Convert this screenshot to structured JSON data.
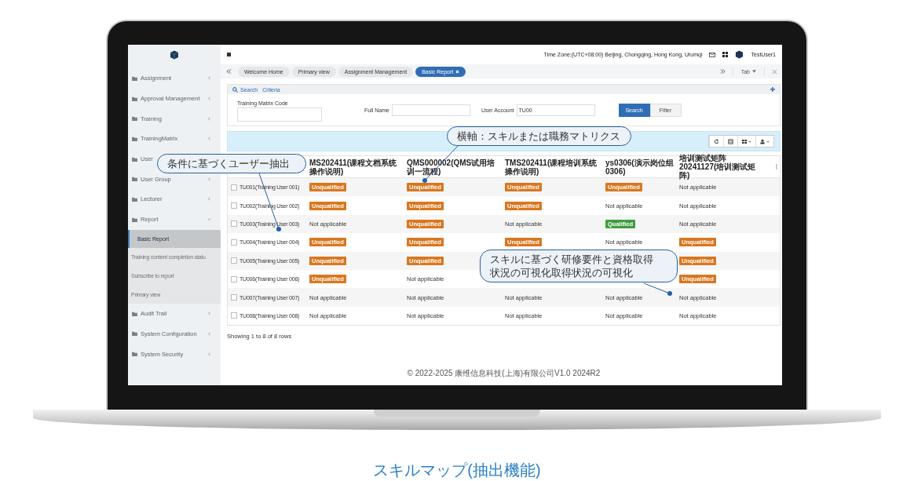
{
  "topbar": {
    "timezone": "Time Zone:(UTC+08:00) Beijing, Chongqing, Hong Kong, Urumqi",
    "user": "TestUser1"
  },
  "sidebar": {
    "items": [
      {
        "label": "Assignment",
        "expanded": false
      },
      {
        "label": "Approval Management",
        "expanded": false
      },
      {
        "label": "Training",
        "expanded": false
      },
      {
        "label": "TrainingMatrix",
        "expanded": false
      },
      {
        "label": "User"
      },
      {
        "label": "User Group",
        "expanded": false
      },
      {
        "label": "Lecturer",
        "expanded": false
      },
      {
        "label": "Report",
        "expanded": true,
        "children": [
          {
            "label": "Basic Report",
            "selected": true
          },
          {
            "label": "Training content completion statu",
            "selected": false
          },
          {
            "label": "Subscribe to report",
            "selected": false
          },
          {
            "label": "Primary view",
            "selected": false
          }
        ]
      },
      {
        "label": "Audit Trail",
        "expanded": false
      },
      {
        "label": "System Configuration",
        "expanded": false
      },
      {
        "label": "System Security",
        "expanded": false
      }
    ]
  },
  "tabs": [
    {
      "label": "Welcome Home",
      "selected": false
    },
    {
      "label": "Primary view",
      "selected": false
    },
    {
      "label": "Assignment Management",
      "selected": false
    },
    {
      "label": "Basic Report",
      "selected": true
    }
  ],
  "tab_menu": "Tab",
  "search_panel": {
    "title": "Search",
    "subtitle": "Criteria",
    "fields": [
      {
        "label": "Training Matrix Code"
      },
      {
        "label": "Full Name"
      },
      {
        "label": "User Account",
        "value": "TU00"
      }
    ],
    "buttons": [
      "Search",
      "Filter"
    ]
  },
  "table": {
    "columns": [
      "MS202411(课程文档系统操作说明)",
      "QMS000002(QMS试用培训一流程)",
      "TMS202411(课程培训系统操作说明)",
      "ys0306(演示岗位组0306)",
      "培训测试矩阵20241127(培训测试矩阵)"
    ],
    "rows": [
      {
        "user": "TU001(Training User 001)",
        "checked": false,
        "cells": [
          {
            "kind": "unqualified",
            "text": "Unqualified"
          },
          {
            "kind": "unqualified",
            "text": "Unqualified"
          },
          {
            "kind": "unqualified",
            "text": "Unqualified"
          },
          {
            "kind": "unqualified",
            "text": "Unqualified"
          },
          {
            "kind": "not_applicable",
            "text": "Not applicable"
          }
        ]
      },
      {
        "user": "TU002(Training User 002)",
        "checked": false,
        "cells": [
          {
            "kind": "unqualified",
            "text": "Unqualified"
          },
          {
            "kind": "unqualified",
            "text": "Unqualified"
          },
          {
            "kind": "unqualified",
            "text": "Unqualified"
          },
          {
            "kind": "not_applicable",
            "text": "Not applicable"
          },
          {
            "kind": "not_applicable",
            "text": "Not applicable"
          }
        ]
      },
      {
        "user": "TU003(Training User 003)",
        "checked": false,
        "cells": [
          {
            "kind": "not_applicable",
            "text": "Not applicable"
          },
          {
            "kind": "unqualified",
            "text": "Unqualified"
          },
          {
            "kind": "not_applicable",
            "text": "Not applicable"
          },
          {
            "kind": "qualified",
            "text": "Qualified"
          },
          {
            "kind": "not_applicable",
            "text": "Not applicable"
          }
        ]
      },
      {
        "user": "TU004(Training User 004)",
        "checked": false,
        "cells": [
          {
            "kind": "unqualified",
            "text": "Unqualified"
          },
          {
            "kind": "unqualified",
            "text": "Unqualified"
          },
          {
            "kind": "unqualified",
            "text": "Unqualified"
          },
          {
            "kind": "not_applicable",
            "text": "Not applicable"
          },
          {
            "kind": "unqualified",
            "text": "Unqualified"
          }
        ]
      },
      {
        "user": "TU005(Training User 005)",
        "checked": false,
        "cells": [
          {
            "kind": "unqualified",
            "text": "Unqualified"
          },
          {
            "kind": "unqualified",
            "text": "Unqualified"
          },
          null,
          null,
          {
            "kind": "unqualified",
            "text": "Unqualified"
          }
        ]
      },
      {
        "user": "TU006(Training User 006)",
        "checked": false,
        "cells": [
          {
            "kind": "unqualified",
            "text": "Unqualified"
          },
          {
            "kind": "not_applicable",
            "text": "Not applicable"
          },
          null,
          null,
          {
            "kind": "unqualified",
            "text": "Unqualified"
          }
        ]
      },
      {
        "user": "TU007(Training User 007)",
        "checked": false,
        "cells": [
          {
            "kind": "not_applicable",
            "text": "Not applicable"
          },
          {
            "kind": "not_applicable",
            "text": "Not applicable"
          },
          {
            "kind": "not_applicable",
            "text": "Not applicable"
          },
          {
            "kind": "not_applicable",
            "text": "Not applicable"
          },
          {
            "kind": "not_applicable",
            "text": "Not applicable"
          }
        ]
      },
      {
        "user": "TU008(Training User 008)",
        "checked": false,
        "cells": [
          {
            "kind": "not_applicable",
            "text": "Not applicable"
          },
          {
            "kind": "not_applicable",
            "text": "Not applicable"
          },
          {
            "kind": "not_applicable",
            "text": "Not applicable"
          },
          {
            "kind": "not_applicable",
            "text": "Not applicable"
          },
          {
            "kind": "not_applicable",
            "text": "Not applicable"
          }
        ]
      }
    ]
  },
  "pagination": "Showing 1 to 8 of 8 rows",
  "footer": "© 2022-2025 康维信息科技(上海)有限公司V1.0 2024R2",
  "callouts": [
    {
      "lines": [
        "条件に基づくユーザー抽出"
      ]
    },
    {
      "lines": [
        "横軸：スキルまたは職務マトリクス"
      ]
    },
    {
      "lines": [
        "スキルに基づく研修要件と資格取得",
        "状況の可視化取得状況の可視化"
      ]
    }
  ],
  "caption": "スキルマップ(抽出機能)"
}
